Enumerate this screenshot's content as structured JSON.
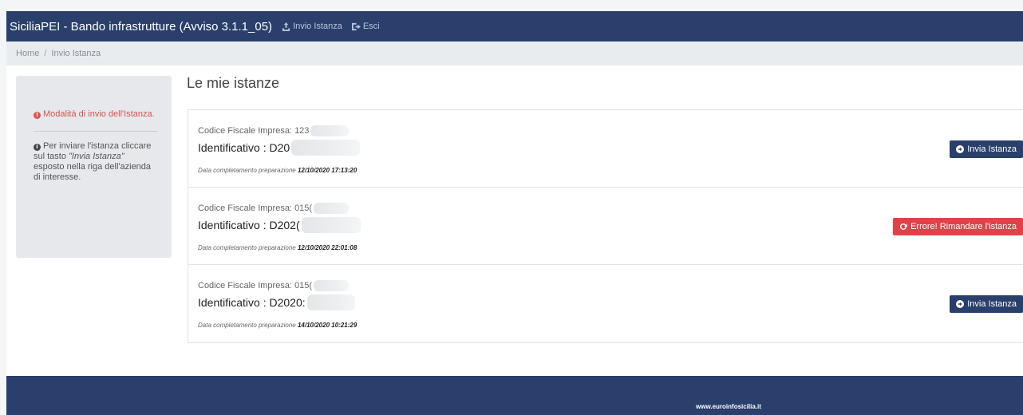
{
  "navbar": {
    "brand": "SiciliaPEI - Bando infrastrutture (Avviso 3.1.1_05)",
    "links": [
      {
        "label": "Invio Istanza",
        "icon": "upload-icon"
      },
      {
        "label": "Esci",
        "icon": "sign-out-icon"
      }
    ]
  },
  "breadcrumb": {
    "home": "Home",
    "separator": "/",
    "current": "Invio Istanza"
  },
  "sidebar": {
    "warning": "Modalità di invio dell'Istanza.",
    "info_prefix": "Per inviare l'istanza cliccare sul tasto ",
    "info_emph": "\"Invia Istanza\"",
    "info_suffix": " esposto nella riga dell'azienda di interesse."
  },
  "main": {
    "title": "Le mie istanze",
    "items": [
      {
        "cf_label": "Codice Fiscale Impresa:",
        "cf_value": "123",
        "id_label": "Identificativo :",
        "id_value": "D20",
        "date_label": "Data completamento preparazione",
        "date_value": "12/10/2020 17:13:20",
        "button_label": "Invia Istanza",
        "button_type": "primary"
      },
      {
        "cf_label": "Codice Fiscale Impresa:",
        "cf_value": "015(",
        "id_label": "Identificativo :",
        "id_value": "D202(",
        "date_label": "Data completamento preparazione",
        "date_value": "12/10/2020 22:01:08",
        "button_label": "Errore! Rimandare l'istanza",
        "button_type": "danger"
      },
      {
        "cf_label": "Codice Fiscale Impresa:",
        "cf_value": "015(",
        "id_label": "Identificativo :",
        "id_value": "D2020:",
        "date_label": "Data completamento preparazione",
        "date_value": "14/10/2020 10:21:29",
        "button_label": "Invia Istanza",
        "button_type": "primary"
      }
    ]
  },
  "footer": {
    "link": "www.euroinfosicilia.it"
  },
  "colors": {
    "navbar": "#2a3f6b",
    "danger": "#e0424a",
    "warning_text": "#d9534f"
  }
}
